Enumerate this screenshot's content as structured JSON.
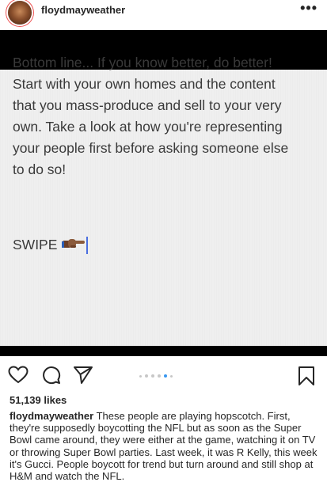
{
  "header": {
    "username": "floydmayweather",
    "more_label": "•••"
  },
  "post": {
    "text_lines": [
      "Bottom line... If you know better, do better!",
      "Start with your own homes and the content",
      "that you mass-produce and sell to your very",
      "own. Take a look at how you're representing",
      "your people first before asking someone else",
      "to do so!"
    ],
    "swipe_label": "SWIPE",
    "swipe_icon": "pointing-hand-icon"
  },
  "carousel": {
    "count": 6,
    "active_index": 4
  },
  "likes": "51,139 likes",
  "caption": {
    "username": "floydmayweather",
    "lines": [
      "These people are playing hopscotch. First,",
      "they're supposedly boycotting the NFL but as soon as the Super",
      "Bowl came around, they were either at the game, watching it on TV",
      "or throwing Super Bowl parties. Last week, it was R Kelly, this week",
      "it's Gucci. People boycott for trend but turn around and still shop at",
      "H&M and watch the NFL."
    ]
  },
  "colors": {
    "accent": "#3897f0",
    "text": "#262626"
  }
}
